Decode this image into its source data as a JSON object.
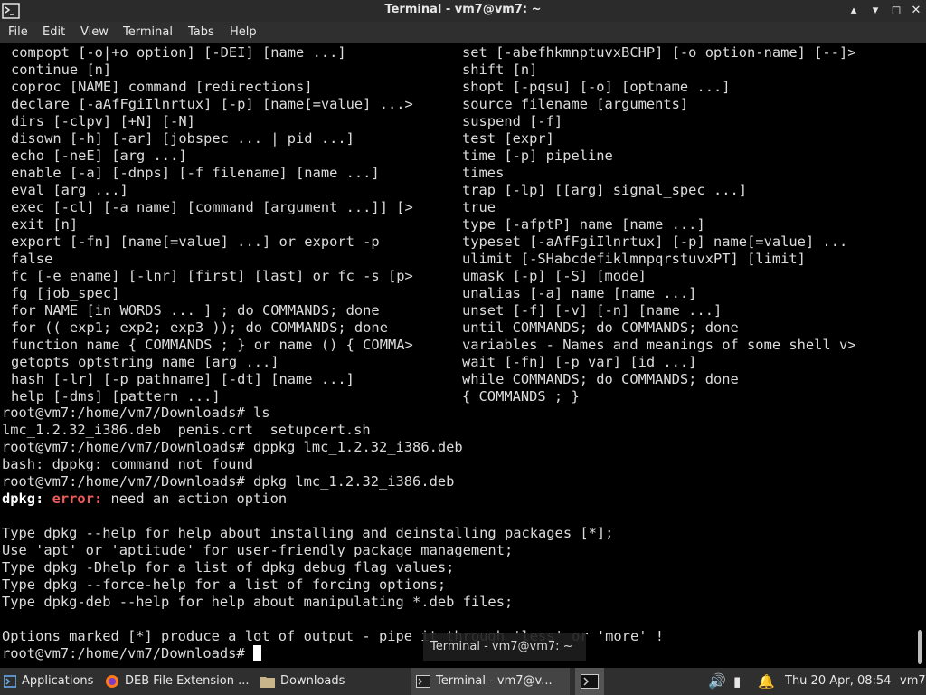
{
  "window": {
    "title": "Terminal - vm7@vm7: ~",
    "minimize": "▴",
    "maximize": "▾",
    "restore": "◻",
    "close": "✕"
  },
  "menu": [
    "File",
    "Edit",
    "View",
    "Terminal",
    "Tabs",
    "Help"
  ],
  "terminal": {
    "help_left": [
      "compopt [-o|+o option] [-DEI] [name ...]",
      "continue [n]",
      "coproc [NAME] command [redirections]",
      "declare [-aAfFgiIlnrtux] [-p] [name[=value] ...>",
      "dirs [-clpv] [+N] [-N]",
      "disown [-h] [-ar] [jobspec ... | pid ...]",
      "echo [-neE] [arg ...]",
      "enable [-a] [-dnps] [-f filename] [name ...]",
      "eval [arg ...]",
      "exec [-cl] [-a name] [command [argument ...]] [>",
      "exit [n]",
      "export [-fn] [name[=value] ...] or export -p",
      "false",
      "fc [-e ename] [-lnr] [first] [last] or fc -s [p>",
      "fg [job_spec]",
      "for NAME [in WORDS ... ] ; do COMMANDS; done",
      "for (( exp1; exp2; exp3 )); do COMMANDS; done",
      "function name { COMMANDS ; } or name () { COMMA>",
      "getopts optstring name [arg ...]",
      "hash [-lr] [-p pathname] [-dt] [name ...]",
      "help [-dms] [pattern ...]"
    ],
    "help_right": [
      "set [-abefhkmnptuvxBCHP] [-o option-name] [--]>",
      "shift [n]",
      "shopt [-pqsu] [-o] [optname ...]",
      "source filename [arguments]",
      "suspend [-f]",
      "test [expr]",
      "time [-p] pipeline",
      "times",
      "trap [-lp] [[arg] signal_spec ...]",
      "true",
      "type [-afptP] name [name ...]",
      "typeset [-aAfFgiIlnrtux] [-p] name[=value] ...",
      "ulimit [-SHabcdefiklmnpqrstuvxPT] [limit]",
      "umask [-p] [-S] [mode]",
      "unalias [-a] name [name ...]",
      "unset [-f] [-v] [-n] [name ...]",
      "until COMMANDS; do COMMANDS; done",
      "variables - Names and meanings of some shell v>",
      "wait [-fn] [-p var] [id ...]",
      "while COMMANDS; do COMMANDS; done",
      "{ COMMANDS ; }"
    ],
    "prompt": "root@vm7:/home/vm7/Downloads#",
    "cmd_ls": "ls",
    "ls_output": "lmc_1.2.32_i386.deb  penis.crt  setupcert.sh",
    "cmd_typo": "dppkg lmc_1.2.32_i386.deb",
    "typo_error": "bash: dppkg: command not found",
    "cmd_dpkg": "dpkg lmc_1.2.32_i386.deb",
    "dpkg_name": "dpkg:",
    "dpkg_error_label": "error:",
    "dpkg_error_msg": "need an action option",
    "dpkg_help": [
      "Type dpkg --help for help about installing and deinstalling packages [*];",
      "Use 'apt' or 'aptitude' for user-friendly package management;",
      "Type dpkg -Dhelp for a list of dpkg debug flag values;",
      "Type dpkg --force-help for a list of forcing options;",
      "Type dpkg-deb --help for help about manipulating *.deb files;"
    ],
    "options_note": "Options marked [*] produce a lot of output - pipe it through 'less' or 'more' !"
  },
  "tooltip": "Terminal - vm7@vm7: ~",
  "taskbar": {
    "applications": "Applications",
    "firefox_task": "DEB File Extension ...",
    "files_task": "Downloads",
    "terminal_task": "Terminal - vm7@v...",
    "clock": "Thu 20 Apr, 08:54",
    "user": "vm7"
  }
}
